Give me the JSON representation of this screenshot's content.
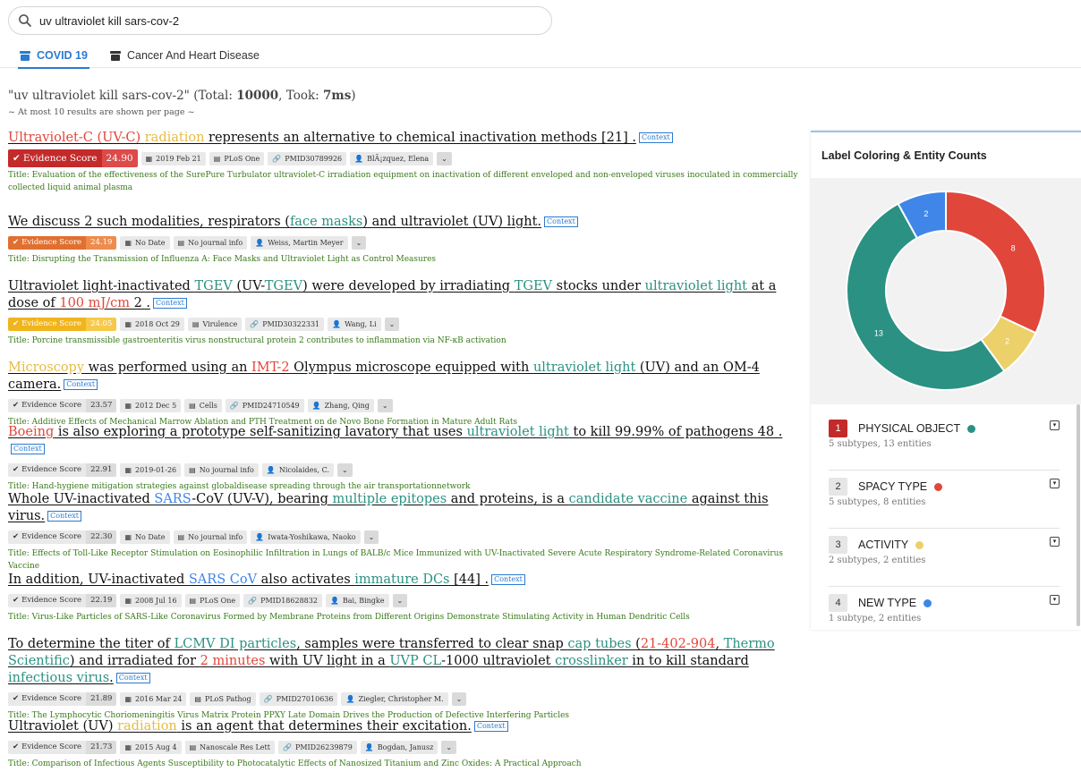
{
  "search": {
    "value": "uv ultraviolet kill sars-cov-2",
    "icon": "search-icon"
  },
  "tabs": [
    {
      "label": "COVID 19",
      "active": true
    },
    {
      "label": "Cancer And Heart Disease",
      "active": false
    }
  ],
  "summary": {
    "query_quoted": "\"uv ultraviolet kill sars-cov-2\"",
    "total_label": "Total:",
    "total": "10000",
    "took_label": "Took:",
    "took": "7ms",
    "note": "~ At most 10 results are shown per page ~"
  },
  "colors": {
    "physical_object": "#2b9182",
    "spacy_type": "#e0473a",
    "activity": "#ecd06a",
    "new_type": "#3f86e8",
    "tab_active": "#2b7bd1",
    "title_green": "#3a7a1a"
  },
  "context_label": "Context",
  "evidence_label": "Evidence Score",
  "results": [
    {
      "segments": [
        {
          "t": "Ultraviolet-C (UV-C)",
          "c": "red"
        },
        {
          "t": " ",
          "c": ""
        },
        {
          "t": "radiation",
          "c": "yellow"
        },
        {
          "t": " represents an alternative to chemical inactivation methods [21] .",
          "c": ""
        }
      ],
      "score": "24.90",
      "date": "2019 Feb 21",
      "journal": "PLoS One",
      "pmid": "PMID30789926",
      "author": "BlÃ¡zquez, Elena",
      "title": "Title: Evaluation of the effectiveness of the SurePure Turbulator ultraviolet-C irradiation equipment on inactivation of different enveloped and non-enveloped viruses inoculated in commercially collected liquid animal plasma"
    },
    {
      "segments": [
        {
          "t": "We discuss 2 such modalities, respirators (",
          "c": ""
        },
        {
          "t": "face masks",
          "c": "teal"
        },
        {
          "t": ") and ultraviolet (UV) light.",
          "c": ""
        }
      ],
      "score": "24.19",
      "date": "No Date",
      "journal": "No journal info",
      "author": "Weiss, Martin Meyer",
      "title": "Title: Disrupting the Transmission of Influenza A: Face Masks and Ultraviolet Light as Control Measures"
    },
    {
      "segments": [
        {
          "t": "Ultraviolet light-inactivated ",
          "c": ""
        },
        {
          "t": "TGEV",
          "c": "teal"
        },
        {
          "t": " (UV-",
          "c": ""
        },
        {
          "t": "TGEV",
          "c": "teal"
        },
        {
          "t": ") were developed by irradiating ",
          "c": ""
        },
        {
          "t": "TGEV",
          "c": "teal"
        },
        {
          "t": " stocks under ",
          "c": ""
        },
        {
          "t": "ultraviolet light",
          "c": "teal"
        },
        {
          "t": " at a dose of ",
          "c": ""
        },
        {
          "t": "100 mJ/cm",
          "c": "red"
        },
        {
          "t": " 2 .",
          "c": ""
        }
      ],
      "score": "24.05",
      "date": "2018 Oct 29",
      "journal": "Virulence",
      "pmid": "PMID30322331",
      "author": "Wang, Li",
      "title": "Title: Porcine transmissible gastroenteritis virus nonstructural protein 2 contributes to inflammation via NF-κB activation"
    },
    {
      "segments": [
        {
          "t": "Microscopy",
          "c": "yellow"
        },
        {
          "t": " was performed using an ",
          "c": ""
        },
        {
          "t": "IMT-2",
          "c": "red"
        },
        {
          "t": " Olympus microscope equipped with ",
          "c": ""
        },
        {
          "t": "ultraviolet light",
          "c": "teal"
        },
        {
          "t": " (UV) and an OM-4 camera.",
          "c": ""
        }
      ],
      "score": "23.57",
      "date": "2012 Dec 5",
      "journal": "Cells",
      "pmid": "PMID24710549",
      "author": "Zhang, Qing",
      "title": "Title: Additive Effects of Mechanical Marrow Ablation and PTH Treatment on de Novo Bone Formation in Mature Adult Rats"
    },
    {
      "segments": [
        {
          "t": "Boeing",
          "c": "red"
        },
        {
          "t": " is also exploring a prototype self-sanitizing lavatory that uses ",
          "c": ""
        },
        {
          "t": "ultraviolet light",
          "c": "teal"
        },
        {
          "t": " to kill 99.99% of pathogens 48 .",
          "c": ""
        }
      ],
      "score": "22.91",
      "date": "2019-01-26",
      "journal": "No journal info",
      "author": "Nicolaides, C.",
      "title": "Title: Hand-hygiene mitigation strategies against globaldisease spreading through the air transportationnetwork"
    },
    {
      "segments": [
        {
          "t": "Whole UV-inactivated ",
          "c": ""
        },
        {
          "t": "SARS",
          "c": "blue"
        },
        {
          "t": "-CoV (UV-V), bearing ",
          "c": ""
        },
        {
          "t": "multiple epitopes",
          "c": "teal"
        },
        {
          "t": " and proteins, is a ",
          "c": ""
        },
        {
          "t": "candidate vaccine",
          "c": "teal"
        },
        {
          "t": " against this virus.",
          "c": ""
        }
      ],
      "score": "22.30",
      "date": "No Date",
      "journal": "No journal info",
      "author": "Iwata-Yoshikawa, Naoko",
      "title": "Title: Effects of Toll-Like Receptor Stimulation on Eosinophilic Infiltration in Lungs of BALB/c Mice Immunized with UV-Inactivated Severe Acute Respiratory Syndrome-Related Coronavirus Vaccine"
    },
    {
      "segments": [
        {
          "t": "In addition, UV-inactivated ",
          "c": ""
        },
        {
          "t": "SARS CoV",
          "c": "blue"
        },
        {
          "t": " also activates ",
          "c": ""
        },
        {
          "t": "immature DCs",
          "c": "teal"
        },
        {
          "t": " [44] .",
          "c": ""
        }
      ],
      "score": "22.19",
      "date": "2008 Jul 16",
      "journal": "PLoS One",
      "pmid": "PMID18628832",
      "author": "Bai, Bingke",
      "title": "Title: Virus-Like Particles of SARS-Like Coronavirus Formed by Membrane Proteins from Different Origins Demonstrate Stimulating Activity in Human Dendritic Cells"
    },
    {
      "segments": [
        {
          "t": "To determine the titer of ",
          "c": ""
        },
        {
          "t": "LCMV DI particles",
          "c": "teal"
        },
        {
          "t": ", samples were transferred to clear snap ",
          "c": ""
        },
        {
          "t": "cap tubes",
          "c": "teal"
        },
        {
          "t": " (",
          "c": ""
        },
        {
          "t": "21-402-904",
          "c": "red"
        },
        {
          "t": ", ",
          "c": ""
        },
        {
          "t": "Thermo Scientific",
          "c": "teal"
        },
        {
          "t": ") and irradiated for ",
          "c": ""
        },
        {
          "t": "2 minutes",
          "c": "red"
        },
        {
          "t": " with UV light in a ",
          "c": ""
        },
        {
          "t": "UVP CL",
          "c": "teal"
        },
        {
          "t": "-1000 ultraviolet ",
          "c": ""
        },
        {
          "t": "crosslinker",
          "c": "teal"
        },
        {
          "t": " in to kill standard ",
          "c": ""
        },
        {
          "t": "infectious virus",
          "c": "teal"
        },
        {
          "t": ".",
          "c": ""
        }
      ],
      "score": "21.89",
      "date": "2016 Mar 24",
      "journal": "PLoS Pathog",
      "pmid": "PMID27010636",
      "author": "Ziegler, Christopher M.",
      "title": "Title: The Lymphocytic Choriomeningitis Virus Matrix Protein PPXY Late Domain Drives the Production of Defective Interfering Particles"
    },
    {
      "segments": [
        {
          "t": "Ultraviolet (UV) ",
          "c": ""
        },
        {
          "t": "radiation",
          "c": "yellow"
        },
        {
          "t": " is an agent that determines their excitation.",
          "c": ""
        }
      ],
      "score": "21.73",
      "date": "2015 Aug 4",
      "journal": "Nanoscale Res Lett",
      "pmid": "PMID26239879",
      "author": "Bogdan, Janusz",
      "title": "Title: Comparison of Infectious Agents Susceptibility to Photocatalytic Effects of Nanosized Titanium and Zinc Oxides: A Practical Approach"
    }
  ],
  "panel": {
    "title": "Label Coloring & Entity Counts",
    "legend": [
      {
        "num": "1",
        "name": "PHYSICAL OBJECT",
        "color": "#2b9182",
        "sub": "5 subtypes, 13 entities"
      },
      {
        "num": "2",
        "name": "SPACY TYPE",
        "color": "#e0473a",
        "sub": "5 subtypes, 8 entities"
      },
      {
        "num": "3",
        "name": "ACTIVITY",
        "color": "#ecd06a",
        "sub": "2 subtypes, 2 entities"
      },
      {
        "num": "4",
        "name": "NEW TYPE",
        "color": "#3f86e8",
        "sub": "1 subtype, 2 entities"
      }
    ]
  },
  "chart_data": {
    "type": "pie",
    "donut": true,
    "categories": [
      "PHYSICAL OBJECT",
      "SPACY TYPE",
      "ACTIVITY",
      "NEW TYPE"
    ],
    "values": [
      13,
      8,
      2,
      2
    ],
    "colors": [
      "#2b9182",
      "#e0473a",
      "#ecd06a",
      "#3f86e8"
    ],
    "order": [
      "NEW TYPE",
      "SPACY TYPE",
      "ACTIVITY",
      "PHYSICAL OBJECT"
    ]
  }
}
